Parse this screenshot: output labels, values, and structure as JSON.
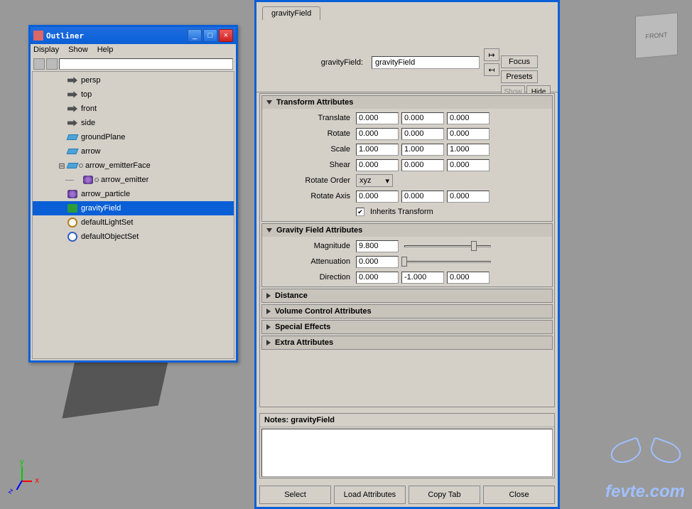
{
  "outliner": {
    "title": "Outliner",
    "menus": {
      "display": "Display",
      "show": "Show",
      "help": "Help"
    },
    "items": [
      {
        "label": "persp",
        "kind": "cam",
        "indent": 0
      },
      {
        "label": "top",
        "kind": "cam",
        "indent": 0
      },
      {
        "label": "front",
        "kind": "cam",
        "indent": 0
      },
      {
        "label": "side",
        "kind": "cam",
        "indent": 0
      },
      {
        "label": "groundPlane",
        "kind": "prim",
        "indent": 0
      },
      {
        "label": "arrow",
        "kind": "prim",
        "indent": 0
      },
      {
        "label": "arrow_emitterFace",
        "kind": "prim",
        "indent": 0,
        "expanded": true,
        "conn": true
      },
      {
        "label": "arrow_emitter",
        "kind": "particle",
        "indent": 1,
        "conn": true
      },
      {
        "label": "arrow_particle",
        "kind": "particle",
        "indent": 0
      },
      {
        "label": "gravityField",
        "kind": "field",
        "indent": 0,
        "selected": true
      },
      {
        "label": "defaultLightSet",
        "kind": "seto",
        "indent": 0
      },
      {
        "label": "defaultObjectSet",
        "kind": "setb",
        "indent": 0
      }
    ]
  },
  "attr": {
    "tab": "gravityField",
    "nameLabel": "gravityField:",
    "nameValue": "gravityField",
    "sideBtns": {
      "focus": "Focus",
      "presets": "Presets",
      "show": "Show",
      "hide": "Hide"
    },
    "sections": {
      "transform": {
        "title": "Transform Attributes",
        "rows": [
          {
            "label": "Translate",
            "v": [
              "0.000",
              "0.000",
              "0.000"
            ]
          },
          {
            "label": "Rotate",
            "v": [
              "0.000",
              "0.000",
              "0.000"
            ]
          },
          {
            "label": "Scale",
            "v": [
              "1.000",
              "1.000",
              "1.000"
            ]
          },
          {
            "label": "Shear",
            "v": [
              "0.000",
              "0.000",
              "0.000"
            ]
          }
        ],
        "rotateOrderLabel": "Rotate Order",
        "rotateOrderValue": "xyz",
        "rotateAxisLabel": "Rotate Axis",
        "rotateAxisValues": [
          "0.000",
          "0.000",
          "0.000"
        ],
        "inheritsLabel": "Inherits Transform"
      },
      "gravity": {
        "title": "Gravity Field Attributes",
        "magLabel": "Magnitude",
        "magValue": "9.800",
        "attLabel": "Attenuation",
        "attValue": "0.000",
        "dirLabel": "Direction",
        "dirValues": [
          "0.000",
          "-1.000",
          "0.000"
        ]
      },
      "collapsed": [
        "Distance",
        "Volume Control Attributes",
        "Special Effects",
        "Extra Attributes"
      ]
    },
    "notesLabel": "Notes:  gravityField",
    "buttons": {
      "select": "Select",
      "load": "Load Attributes",
      "copy": "Copy Tab",
      "close": "Close"
    }
  },
  "watermark": "fevte.com",
  "cubeLabel": "FRONT"
}
